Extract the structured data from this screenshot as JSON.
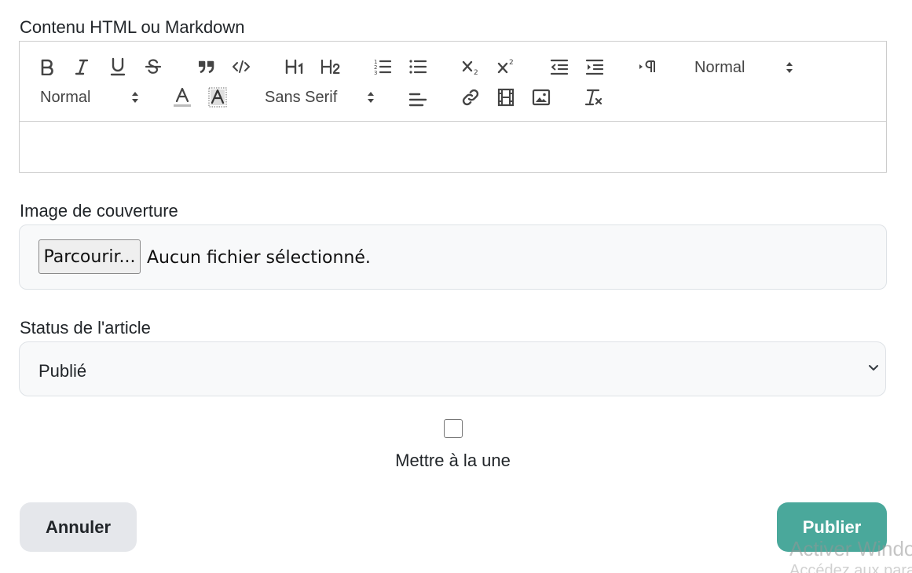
{
  "editor": {
    "label": "Contenu HTML ou Markdown",
    "toolbar": {
      "header_picker": "Normal",
      "size_picker": "Normal",
      "font_picker": "Sans Serif",
      "h1": "H1",
      "h2": "H2"
    }
  },
  "cover": {
    "label": "Image de couverture",
    "browse_button": "Parcourir...",
    "status": "Aucun fichier sélectionné."
  },
  "status": {
    "label": "Status de l'article",
    "selected": "Publié"
  },
  "featured": {
    "label": "Mettre à la une"
  },
  "actions": {
    "cancel": "Annuler",
    "publish": "Publier"
  },
  "watermark": {
    "line1": "Activer Windows",
    "line2": "Accédez aux paramètres"
  },
  "colors": {
    "publish": "#4aa89b",
    "cancel": "#e5e7eb"
  }
}
